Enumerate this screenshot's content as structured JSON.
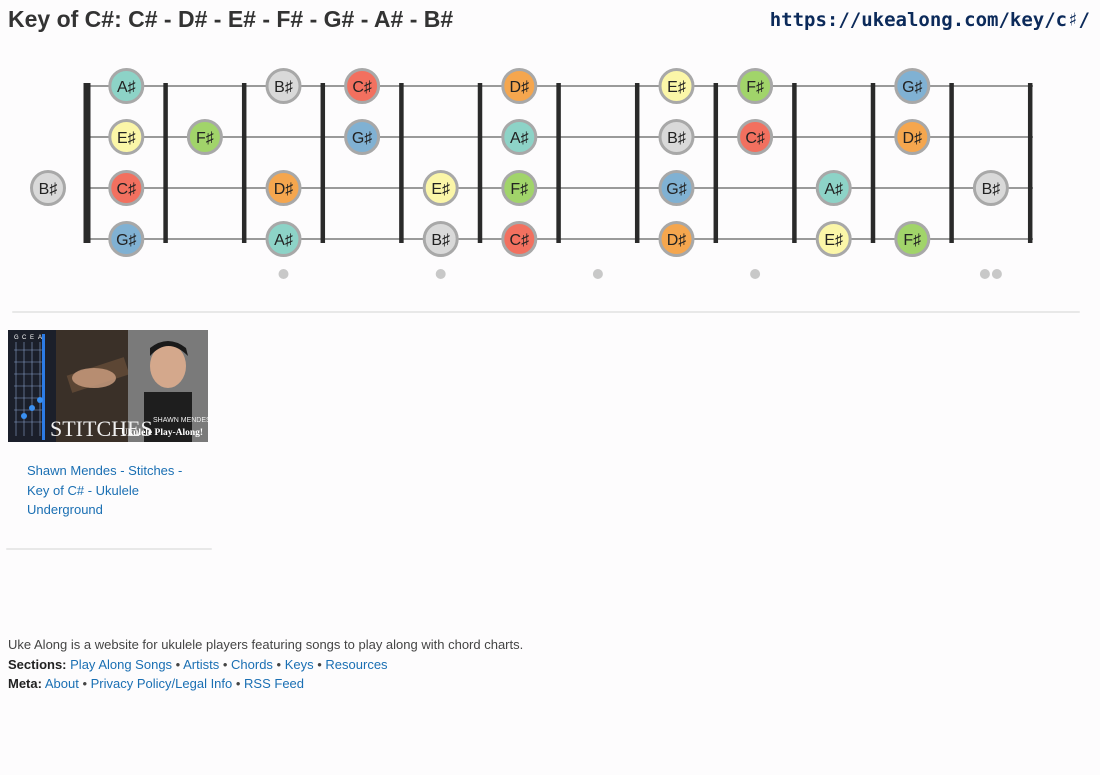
{
  "page": {
    "title": "Key of C#: C# - D# - E# - F# - G# - A# - B#",
    "url": "https://ukealong.com/key/c♯/"
  },
  "fretboard": {
    "string_count": 4,
    "fret_count": 12,
    "inlay_frets": [
      3,
      5,
      7,
      9,
      12
    ],
    "note_colors": {
      "C♯": "#f2705f",
      "D♯": "#f5a64e",
      "E♯": "#fbf6a8",
      "F♯": "#a1d46a",
      "G♯": "#80b1d3",
      "A♯": "#8dd3c7",
      "B♯": "#d9d9d9"
    },
    "notes": [
      {
        "string": 2,
        "fret": 0,
        "label": "B♯"
      },
      {
        "string": 0,
        "fret": 1,
        "label": "A♯"
      },
      {
        "string": 1,
        "fret": 1,
        "label": "E♯"
      },
      {
        "string": 2,
        "fret": 1,
        "label": "C♯"
      },
      {
        "string": 3,
        "fret": 1,
        "label": "G♯"
      },
      {
        "string": 1,
        "fret": 2,
        "label": "F♯"
      },
      {
        "string": 0,
        "fret": 3,
        "label": "B♯"
      },
      {
        "string": 2,
        "fret": 3,
        "label": "D♯"
      },
      {
        "string": 3,
        "fret": 3,
        "label": "A♯"
      },
      {
        "string": 0,
        "fret": 4,
        "label": "C♯"
      },
      {
        "string": 1,
        "fret": 4,
        "label": "G♯"
      },
      {
        "string": 2,
        "fret": 5,
        "label": "E♯"
      },
      {
        "string": 3,
        "fret": 5,
        "label": "B♯"
      },
      {
        "string": 0,
        "fret": 6,
        "label": "D♯"
      },
      {
        "string": 1,
        "fret": 6,
        "label": "A♯"
      },
      {
        "string": 2,
        "fret": 6,
        "label": "F♯"
      },
      {
        "string": 3,
        "fret": 6,
        "label": "C♯"
      },
      {
        "string": 0,
        "fret": 8,
        "label": "E♯"
      },
      {
        "string": 1,
        "fret": 8,
        "label": "B♯"
      },
      {
        "string": 2,
        "fret": 8,
        "label": "G♯"
      },
      {
        "string": 3,
        "fret": 8,
        "label": "D♯"
      },
      {
        "string": 0,
        "fret": 9,
        "label": "F♯"
      },
      {
        "string": 1,
        "fret": 9,
        "label": "C♯"
      },
      {
        "string": 2,
        "fret": 10,
        "label": "A♯"
      },
      {
        "string": 3,
        "fret": 10,
        "label": "E♯"
      },
      {
        "string": 0,
        "fret": 11,
        "label": "G♯"
      },
      {
        "string": 1,
        "fret": 11,
        "label": "D♯"
      },
      {
        "string": 3,
        "fret": 11,
        "label": "F♯"
      },
      {
        "string": 2,
        "fret": 12,
        "label": "B♯"
      }
    ]
  },
  "related": {
    "thumbnail": {
      "overlay_title": "STITCHES",
      "overlay_artist": "SHAWN MENDES",
      "overlay_subtitle": "Ukulele Play-Along!",
      "tuning_labels": [
        "G",
        "C",
        "E",
        "A"
      ]
    },
    "link_text": "Shawn Mendes - Stitches - Key of C# - Ukulele Underground"
  },
  "footer": {
    "description": "Uke Along is a website for ukulele players featuring songs to play along with chord charts.",
    "sections_label": "Sections:",
    "sections": [
      "Play Along Songs",
      "Artists",
      "Chords",
      "Keys",
      "Resources"
    ],
    "meta_label": "Meta:",
    "meta": [
      "About",
      "Privacy Policy/Legal Info",
      "RSS Feed"
    ],
    "separator": "•"
  }
}
